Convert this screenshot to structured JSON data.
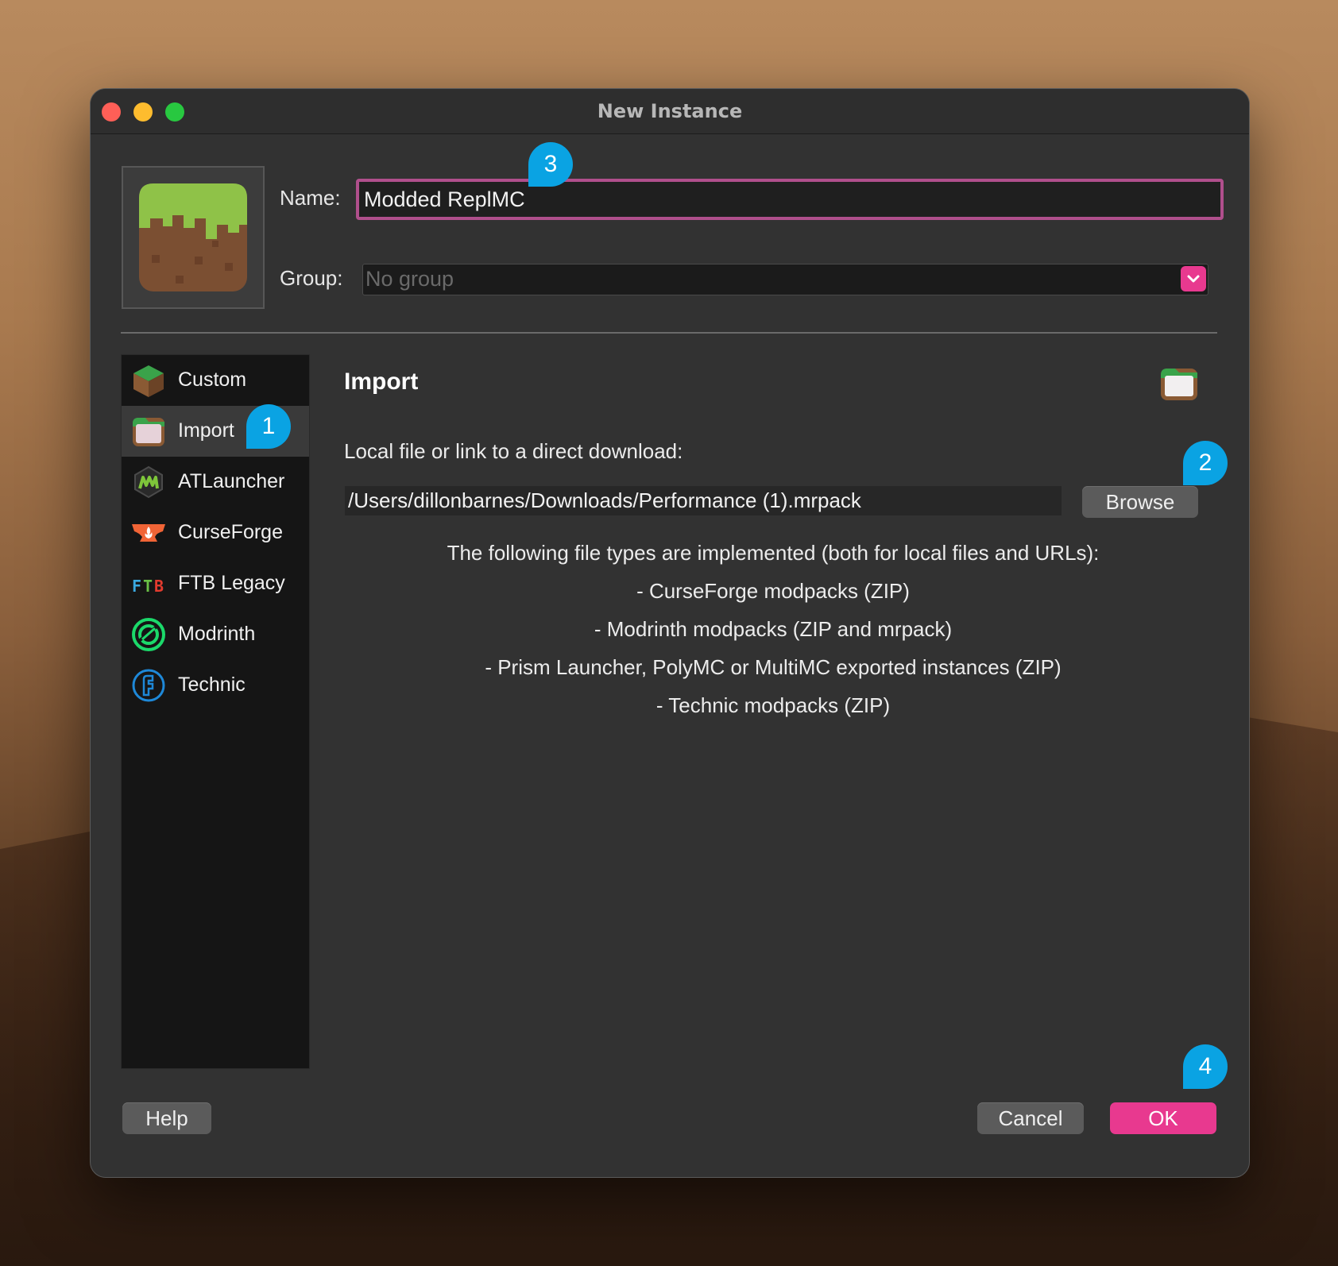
{
  "window": {
    "title": "New Instance"
  },
  "form": {
    "name_label": "Name:",
    "name_value": "Modded ReplMC",
    "group_label": "Group:",
    "group_placeholder": "No group"
  },
  "sidebar": {
    "items": [
      {
        "label": "Custom",
        "icon": "grass-cube-icon",
        "selected": false
      },
      {
        "label": "Import",
        "icon": "folder-icon",
        "selected": true
      },
      {
        "label": "ATLauncher",
        "icon": "atlauncher-icon",
        "selected": false
      },
      {
        "label": "CurseForge",
        "icon": "curseforge-anvil-icon",
        "selected": false
      },
      {
        "label": "FTB Legacy",
        "icon": "ftb-icon",
        "selected": false
      },
      {
        "label": "Modrinth",
        "icon": "modrinth-icon",
        "selected": false
      },
      {
        "label": "Technic",
        "icon": "technic-icon",
        "selected": false
      }
    ]
  },
  "content": {
    "title": "Import",
    "local_label": "Local file or link to a direct download:",
    "path_value": "/Users/dillonbarnes/Downloads/Performance (1).mrpack",
    "browse_label": "Browse",
    "info_lines": [
      "The following file types are implemented (both for local files and URLs):",
      "- CurseForge modpacks (ZIP)",
      "- Modrinth modpacks (ZIP and mrpack)",
      "- Prism Launcher, PolyMC or MultiMC exported instances (ZIP)",
      "- Technic modpacks (ZIP)"
    ]
  },
  "footer": {
    "help_label": "Help",
    "cancel_label": "Cancel",
    "ok_label": "OK"
  },
  "badges": [
    "1",
    "2",
    "3",
    "4"
  ],
  "colors": {
    "accent": "#e8398f",
    "badge": "#0aa3e3",
    "name_border": "#b04f8c"
  }
}
